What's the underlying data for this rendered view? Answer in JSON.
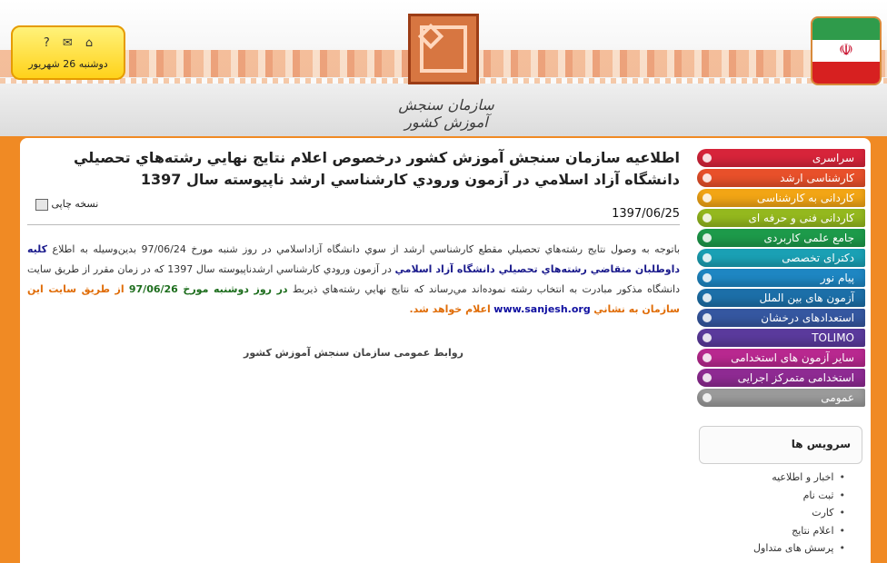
{
  "header": {
    "date": "دوشنبه 26 شهریور",
    "org_name": "سازمان سنجش آموزش کشور",
    "tool_icons": [
      "home-icon",
      "mail-icon",
      "help-icon"
    ]
  },
  "article": {
    "title": "اطلاعيه سازمان سنجش آموزش کشور درخصوص اعلام نتايج نهايي رشته‌هاي تحصيلي دانشگاه آزاد اسلامي در آزمون ورودي کارشناسي ارشد ناپيوسته سال 1397",
    "date": "1397/06/25",
    "print_label": "نسخه چاپی",
    "body_p1": "باتوجه به وصول نتايج رشته‌هاي تحصيلي مقطع کارشناسي ارشد از سوي دانشگاه آزاداسلامي در روز شنبه مورخ 97/06/24 بدين‌وسيله به اطلاع",
    "body_hl1": "کليه داوطلبان متقاضي رشته‌هاي تحصيلي دانشگاه آزاد اسلامي",
    "body_p2": "در آزمون ورودي کارشناسي ارشدناپيوسته سال 1397 که در زمان مقرر از طريق سايت دانشگاه مذکور مبادرت به انتخاب رشته نموده‌اند مي‌رساند که نتايج نهايي رشته‌هاي ذيربط",
    "body_hl2": "در روز دوشنبه مورخ 97/06/26",
    "body_hl3": "از طريق سايت اين سازمان به نشاني",
    "body_link": "www.sanjesh.org",
    "body_hl4": "اعلام خواهد شد.",
    "signature": "روابط عمومی سازمان سنجش آموزش کشور"
  },
  "menu": [
    {
      "label": "سراسری",
      "color": "#d7243a"
    },
    {
      "label": "کارشناسی ارشد",
      "color": "#e8502a"
    },
    {
      "label": "کاردانی به کارشناسی",
      "color": "#f2a515"
    },
    {
      "label": "کاردانی فنی و حرفه ای",
      "color": "#94b81e"
    },
    {
      "label": "جامع علمی کاربردی",
      "color": "#1d9a4a"
    },
    {
      "label": "دکترای تخصصی",
      "color": "#1aa0b4"
    },
    {
      "label": "پیام نور",
      "color": "#1e86c2"
    },
    {
      "label": "آزمون های بین الملل",
      "color": "#1c6fa8"
    },
    {
      "label": "استعدادهای درخشان",
      "color": "#3557a0"
    },
    {
      "label": "TOLIMO",
      "color": "#5a3a9c"
    },
    {
      "label": "سایر آزمون های استخدامی",
      "color": "#b8288f"
    },
    {
      "label": "استخدامی متمرکز اجرایی",
      "color": "#8e2a92"
    },
    {
      "label": "عمومی",
      "color": "#9a9a9a"
    }
  ],
  "services": {
    "title": "سرویس ها",
    "items": [
      "اخبار و اطلاعیه",
      "ثبت نام",
      "کارت",
      "اعلام نتایج",
      "پرسش های متداول"
    ]
  }
}
